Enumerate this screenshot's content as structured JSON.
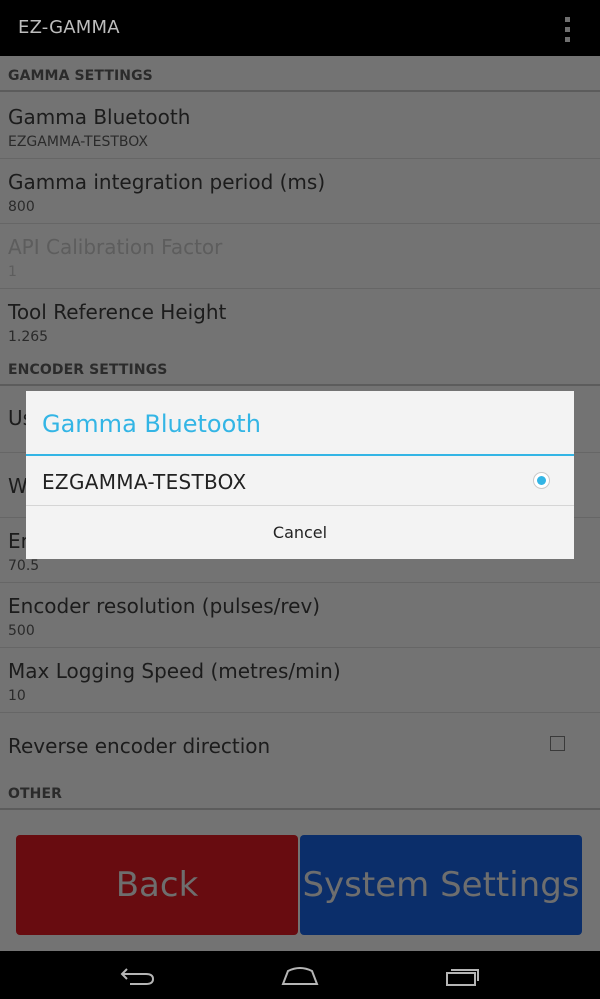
{
  "app": {
    "title": "EZ-GAMMA"
  },
  "colors": {
    "accent": "#33b5e5",
    "back_button": "#680c10",
    "system_button": "#0b2e6a"
  },
  "sections": {
    "gamma": "GAMMA SETTINGS",
    "encoder": "ENCODER SETTINGS",
    "other": "OTHER"
  },
  "prefs": {
    "gamma_bluetooth": {
      "title": "Gamma Bluetooth",
      "summary": "EZGAMMA-TESTBOX"
    },
    "gamma_integration": {
      "title": "Gamma integration period (ms)",
      "summary": "800"
    },
    "api_calibration": {
      "title": "API Calibration Factor",
      "summary": "1"
    },
    "tool_height": {
      "title": "Tool Reference Height",
      "summary": "1.265"
    },
    "enc_row1": {
      "title": "Us"
    },
    "enc_row2": {
      "title": "W"
    },
    "enc_row3": {
      "title": "En",
      "summary": "70.5"
    },
    "encoder_resolution": {
      "title": "Encoder resolution (pulses/rev)",
      "summary": "500"
    },
    "max_logging_speed": {
      "title": "Max Logging Speed (metres/min)",
      "summary": "10"
    },
    "reverse_encoder": {
      "title": "Reverse encoder direction",
      "checked": false
    }
  },
  "buttons": {
    "back": "Back",
    "system_settings": "System Settings"
  },
  "dialog": {
    "title": "Gamma Bluetooth",
    "options": [
      "EZGAMMA-TESTBOX"
    ],
    "selected": "EZGAMMA-TESTBOX",
    "cancel": "Cancel"
  },
  "navbar": {
    "icons": [
      "back-icon",
      "home-icon",
      "recent-apps-icon"
    ]
  }
}
